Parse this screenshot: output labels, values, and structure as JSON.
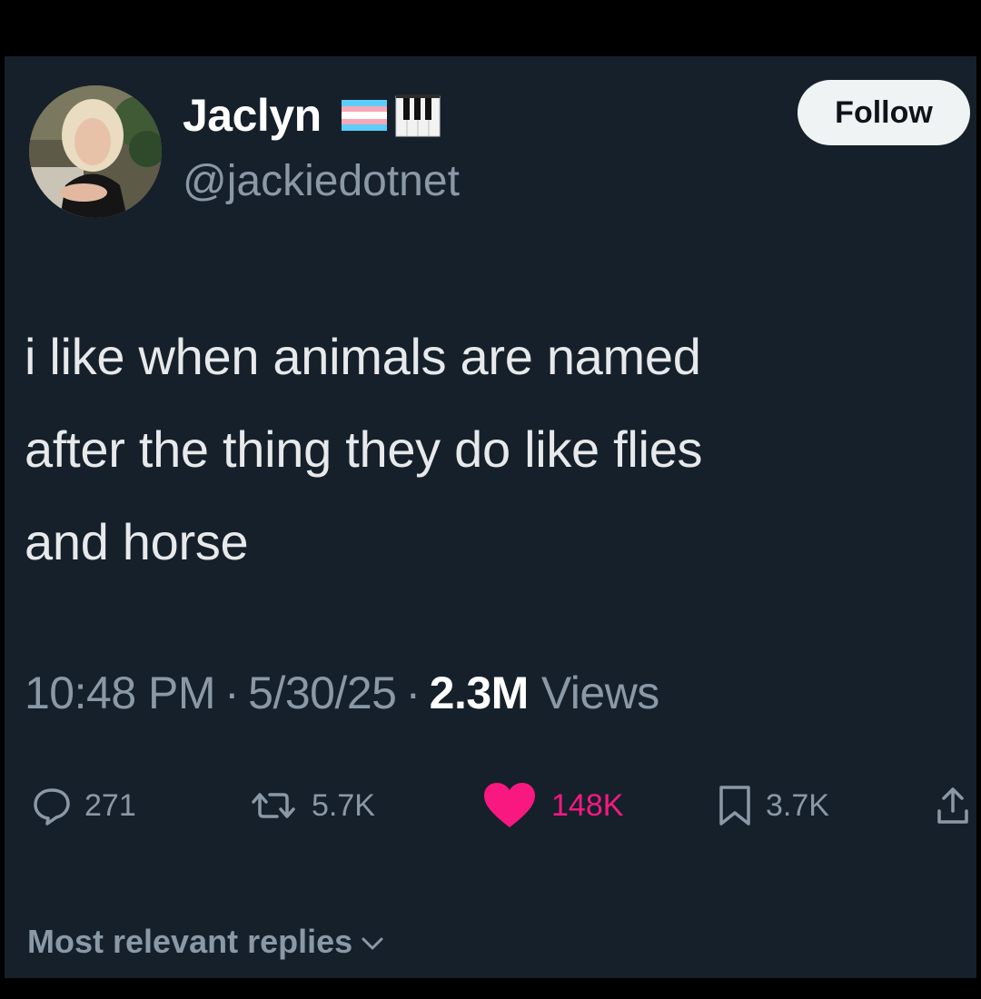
{
  "author": {
    "display_name": "Jaclyn",
    "handle": "@jackiedotnet",
    "badges": [
      "transgender-flag-emoji",
      "musical-keyboard-emoji"
    ]
  },
  "follow_button": {
    "label": "Follow"
  },
  "tweet": {
    "lines": [
      "i like when animals are named",
      "after the thing they do like flies",
      "and horse"
    ]
  },
  "meta": {
    "time": "10:48 PM",
    "date": "5/30/25",
    "separator": "·",
    "views_count": "2.3M",
    "views_label": "Views"
  },
  "actions": {
    "replies": {
      "icon": "reply-icon",
      "count": "271"
    },
    "reposts": {
      "icon": "repost-icon",
      "count": "5.7K"
    },
    "likes": {
      "icon": "heart-icon",
      "count": "148K",
      "color": "#f91880"
    },
    "bookmarks": {
      "icon": "bookmark-icon",
      "count": "3.7K"
    },
    "share": {
      "icon": "share-icon"
    }
  },
  "replies_sort": {
    "label": "Most relevant replies"
  },
  "colors": {
    "background": "#15202b",
    "outer_background": "#000000",
    "primary_text": "#e7e9ea",
    "secondary_text": "#8b98a5",
    "like_accent": "#f91880"
  }
}
